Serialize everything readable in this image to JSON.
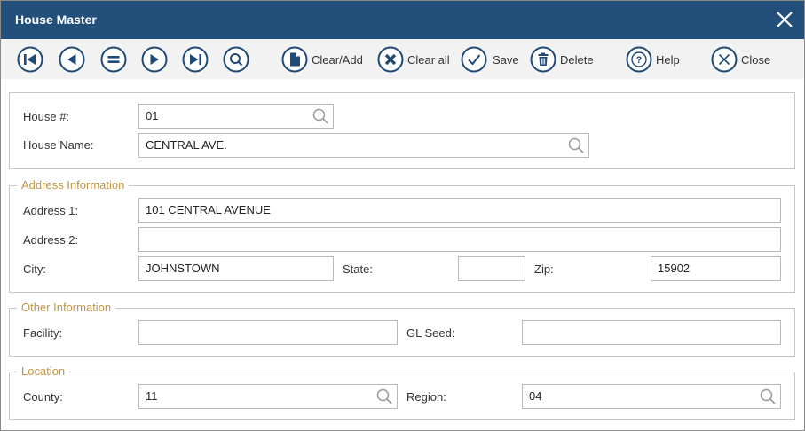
{
  "window": {
    "title": "House Master"
  },
  "toolbar": {
    "clear_add": "Clear/Add",
    "clear_all": "Clear all",
    "save": "Save",
    "delete": "Delete",
    "help": "Help",
    "close": "Close"
  },
  "house": {
    "house_num_label": "House #:",
    "house_num_value": "01",
    "house_name_label": "House Name:",
    "house_name_value": "CENTRAL AVE."
  },
  "address": {
    "legend": "Address Information",
    "address1_label": "Address 1:",
    "address1_value": "101 CENTRAL AVENUE",
    "address2_label": "Address 2:",
    "address2_value": "",
    "city_label": "City:",
    "city_value": "JOHNSTOWN",
    "state_label": "State:",
    "state_value": "",
    "zip_label": "Zip:",
    "zip_value": "15902"
  },
  "other": {
    "legend": "Other Information",
    "facility_label": "Facility:",
    "facility_value": "",
    "gl_seed_label": "GL Seed:",
    "gl_seed_value": ""
  },
  "location": {
    "legend": "Location",
    "county_label": "County:",
    "county_value": "11",
    "region_label": "Region:",
    "region_value": "04"
  },
  "colors": {
    "titlebar": "#234f7b",
    "icon": "#1f4a78",
    "legend": "#c19544"
  }
}
